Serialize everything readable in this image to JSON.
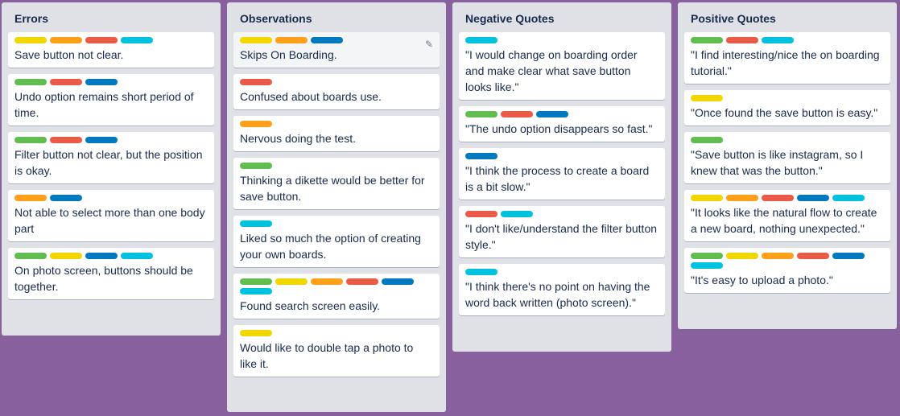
{
  "colors": {
    "green": "#61bd4f",
    "yellow": "#f2d600",
    "orange": "#ff9f1a",
    "red": "#eb5a46",
    "blue": "#0079bf",
    "sky": "#00c2e0",
    "board_bg": "#89609e"
  },
  "lists": [
    {
      "title": "Errors",
      "cards": [
        {
          "labels": [
            "yellow",
            "orange",
            "red",
            "sky"
          ],
          "text": "Save button not clear."
        },
        {
          "labels": [
            "green",
            "red",
            "blue"
          ],
          "text": "Undo option remains short period of time."
        },
        {
          "labels": [
            "green",
            "red",
            "blue"
          ],
          "text": "Filter button not clear, but the position is okay."
        },
        {
          "labels": [
            "orange",
            "blue"
          ],
          "text": "Not able to select more than one body part"
        },
        {
          "labels": [
            "green",
            "yellow",
            "blue",
            "sky"
          ],
          "text": "On photo screen, buttons should be together."
        }
      ]
    },
    {
      "title": "Observations",
      "cards": [
        {
          "labels": [
            "yellow",
            "orange",
            "blue"
          ],
          "text": "Skips On Boarding.",
          "hover": true,
          "edit_icon": "pencil-icon"
        },
        {
          "labels": [
            "red"
          ],
          "text": "Confused about boards use."
        },
        {
          "labels": [
            "orange"
          ],
          "text": "Nervous doing the test."
        },
        {
          "labels": [
            "green"
          ],
          "text": "Thinking a dikette would be better for save button."
        },
        {
          "labels": [
            "sky"
          ],
          "text": "Liked so much the option of creating your own boards."
        },
        {
          "labels": [
            "green",
            "yellow",
            "orange",
            "red",
            "blue",
            "sky"
          ],
          "text": "Found search screen easily."
        },
        {
          "labels": [
            "yellow"
          ],
          "text": "Would like to double tap a photo to like it."
        }
      ]
    },
    {
      "title": "Negative Quotes",
      "cards": [
        {
          "labels": [
            "sky"
          ],
          "text": "\"I would change on boarding order and make clear what save button looks like.\""
        },
        {
          "labels": [
            "green",
            "red",
            "blue"
          ],
          "text": "\"The undo option disappears so fast.\""
        },
        {
          "labels": [
            "blue"
          ],
          "text": "\"I think the process to create a board is a bit slow.\""
        },
        {
          "labels": [
            "red",
            "sky"
          ],
          "text": "\"I don't like/understand the filter button style.\""
        },
        {
          "labels": [
            "sky"
          ],
          "text": "\"I think there's no point on having the word back written (photo screen).\""
        }
      ]
    },
    {
      "title": "Positive Quotes",
      "cards": [
        {
          "labels": [
            "green",
            "red",
            "sky"
          ],
          "text": "\"I find interesting/nice the on boarding tutorial.\""
        },
        {
          "labels": [
            "yellow"
          ],
          "text": "\"Once found the save button is easy.\""
        },
        {
          "labels": [
            "green"
          ],
          "text": "\"Save button is like instagram, so I knew that was the button.\""
        },
        {
          "labels": [
            "yellow",
            "orange",
            "red",
            "blue",
            "sky"
          ],
          "text": "\"It looks like the natural flow to create a new board, nothing unexpected.\""
        },
        {
          "labels": [
            "green",
            "yellow",
            "orange",
            "red",
            "blue",
            "sky"
          ],
          "text": "\"It's easy to upload a photo.\""
        }
      ]
    }
  ]
}
